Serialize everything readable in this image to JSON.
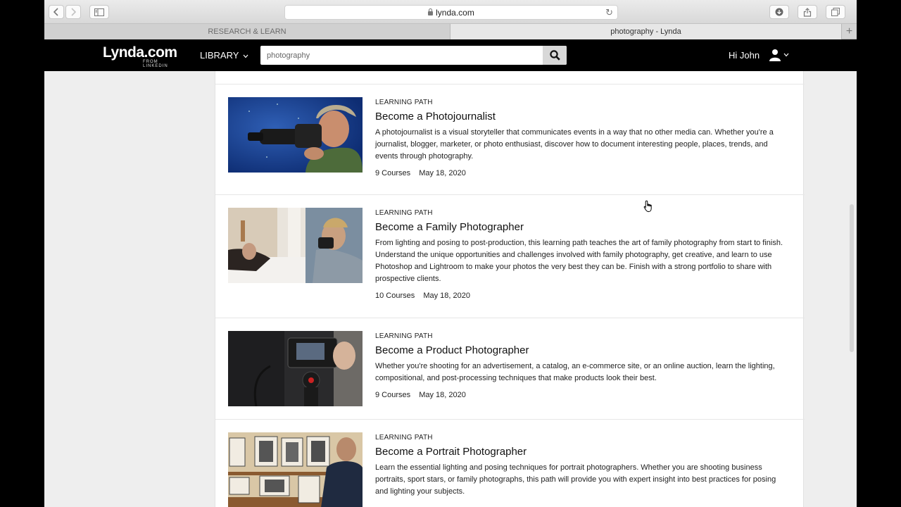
{
  "browser": {
    "url": "lynda.com",
    "tabs": [
      {
        "label": "RESEARCH & LEARN"
      },
      {
        "label": "photography - Lynda"
      }
    ]
  },
  "site": {
    "logo": "Lynda.com",
    "logo_sub": "FROM LINKEDIN",
    "library_label": "LIBRARY",
    "search": {
      "value": "photography",
      "placeholder": "Search"
    },
    "greeting": "Hi John"
  },
  "results": [
    {
      "kind": "LEARNING PATH",
      "title": "Become a Photojournalist",
      "description": "A photojournalist is a visual storyteller that communicates events in a way that no other media can. Whether you're a journalist, blogger, marketer, or photo enthusiast, discover how to document interesting people, places, trends, and events through photography.",
      "courses": "9 Courses",
      "date": "May 18, 2020"
    },
    {
      "kind": "LEARNING PATH",
      "title": "Become a Family Photographer",
      "description": "From lighting and posing to post-production, this learning path teaches the art of family photography from start to finish. Understand the unique opportunities and challenges involved with family photography, get creative, and learn to use Photoshop and Lightroom to make your photos the very best they can be. Finish with a strong portfolio to share with prospective clients.",
      "courses": "10 Courses",
      "date": "May 18, 2020"
    },
    {
      "kind": "LEARNING PATH",
      "title": "Become a Product Photographer",
      "description": "Whether you're shooting for an advertisement, a catalog, an e-commerce site, or an online auction, learn the lighting, compositional, and post-processing techniques that make products look their best.",
      "courses": "9 Courses",
      "date": "May 18, 2020"
    },
    {
      "kind": "LEARNING PATH",
      "title": "Become a Portrait Photographer",
      "description": "Learn the essential lighting and posing techniques for portrait photographers. Whether you are shooting business portraits, sport stars, or family photographs, this path will provide you with expert insight into best practices for posing and lighting your subjects."
    }
  ]
}
